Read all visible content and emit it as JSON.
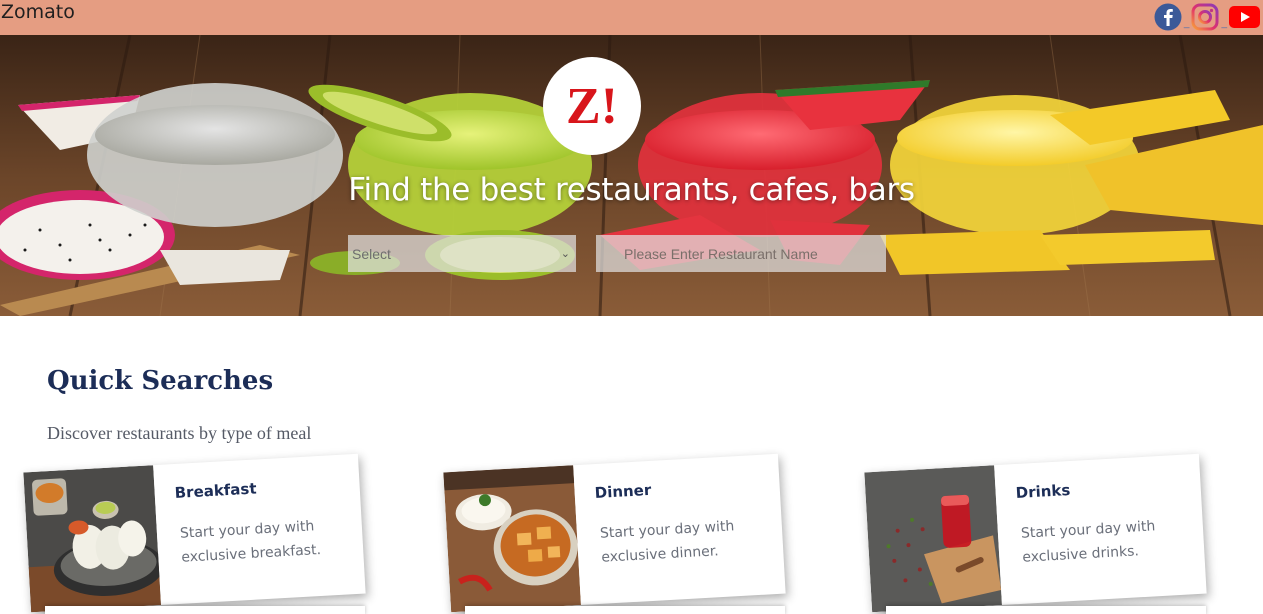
{
  "header": {
    "brand": "Zomato",
    "social_icons": [
      "facebook-icon",
      "instagram-icon",
      "youtube-icon"
    ],
    "bar_color": "#e59d82"
  },
  "hero": {
    "logo_text": "Z!",
    "tagline": "Find the best restaurants, cafes, bars",
    "location_select": {
      "selected": "Select"
    },
    "restaurant_search": {
      "placeholder": "Please Enter Restaurant Name",
      "value": ""
    }
  },
  "quick_searches": {
    "title": "Quick Searches",
    "subtitle": "Discover restaurants by type of meal",
    "cards": [
      {
        "title": "Breakfast",
        "description": "Start your day with exclusive breakfast.",
        "image": "breakfast-image"
      },
      {
        "title": "Dinner",
        "description": "Start your day with exclusive dinner.",
        "image": "dinner-image"
      },
      {
        "title": "Drinks",
        "description": "Start your day with exclusive drinks.",
        "image": "drinks-image"
      }
    ]
  },
  "colors": {
    "heading": "#1c2d57",
    "logo_red": "#d8151b"
  }
}
